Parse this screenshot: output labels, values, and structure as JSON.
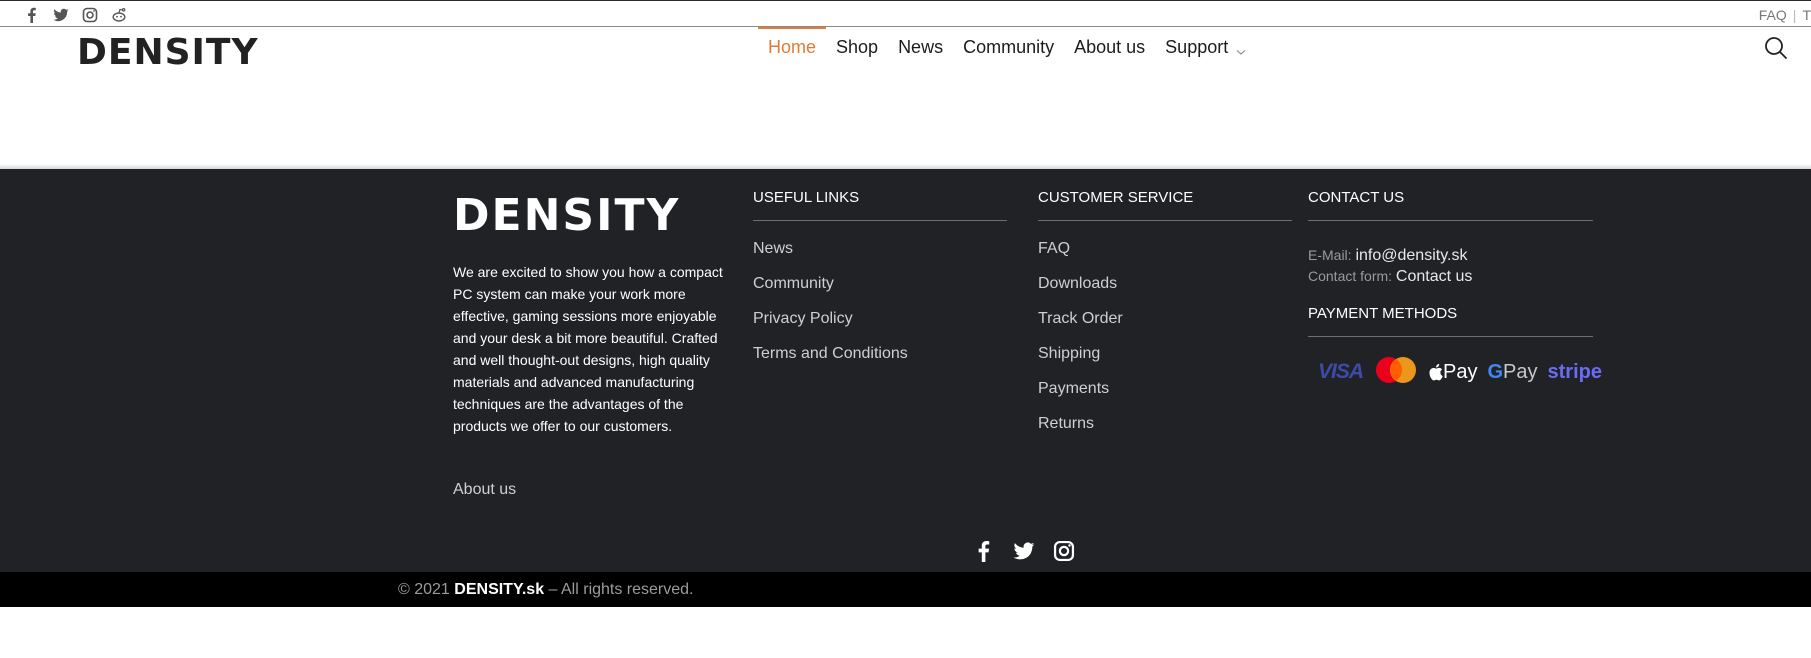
{
  "topbar": {
    "social_icons": [
      "facebook-icon",
      "twitter-icon",
      "instagram-icon",
      "reddit-icon"
    ],
    "links": [
      "FAQ",
      "T"
    ]
  },
  "header": {
    "logo": "DENSITY",
    "nav": [
      {
        "label": "Home",
        "active": true
      },
      {
        "label": "Shop"
      },
      {
        "label": "News"
      },
      {
        "label": "Community"
      },
      {
        "label": "About us"
      },
      {
        "label": "Support",
        "has_dropdown": true
      }
    ],
    "accent": "#e07a34"
  },
  "footer": {
    "logo": "DENSITY",
    "about_text": "We are excited to show you how a compact PC system can make your work more effective, gaming sessions more enjoyable and your desk a bit more beautiful. Crafted and well thought-out designs, high quality materials and advanced manufacturing techniques are the advantages of the products we offer to our customers.",
    "about_link": "About us",
    "useful_links": {
      "title": "USEFUL LINKS",
      "items": [
        "News",
        "Community",
        "Privacy Policy",
        "Terms and Conditions"
      ]
    },
    "customer_service": {
      "title": "CUSTOMER SERVICE",
      "items": [
        "FAQ",
        "Downloads",
        "Track Order",
        "Shipping",
        "Payments",
        "Returns"
      ]
    },
    "contact": {
      "title": "CONTACT US",
      "email_label": "E-Mail:",
      "email": "info@density.sk",
      "form_label": "Contact form:",
      "form_link": "Contact us"
    },
    "payment": {
      "title": "PAYMENT METHODS",
      "visa": "VISA",
      "apple_pay": "Pay",
      "google_pay": "Pay",
      "stripe": "stripe"
    },
    "social_icons": [
      "facebook-icon",
      "twitter-icon",
      "instagram-icon"
    ],
    "bg": "#212226"
  },
  "bottom": {
    "year": "© 2021",
    "brand": "DENSITY.sk",
    "rights": "– All rights reserved."
  }
}
